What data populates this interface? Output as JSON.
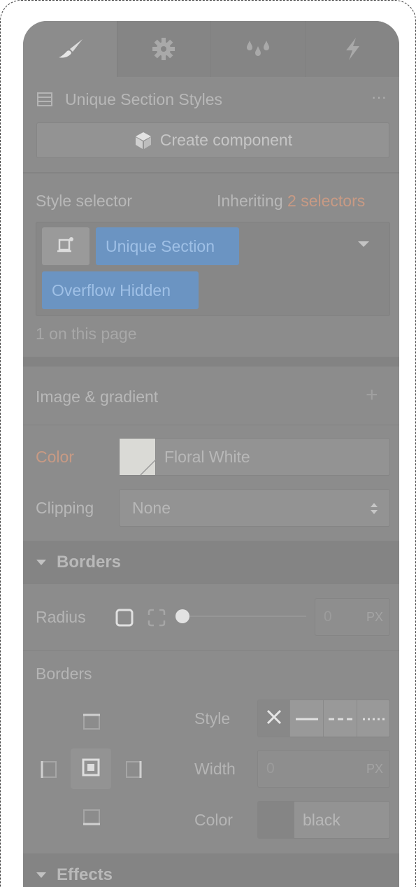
{
  "panel": {
    "tabs": [
      {
        "name": "brush-icon"
      },
      {
        "name": "gear-icon"
      },
      {
        "name": "drops-icon"
      },
      {
        "name": "lightning-icon"
      }
    ]
  },
  "element": {
    "title": "Unique Section Styles",
    "more_label": "···",
    "create_component_label": "Create component"
  },
  "selector": {
    "label": "Style selector",
    "inheriting_prefix": "Inheriting",
    "inheriting_count_label": "2 selectors",
    "tags": [
      "Unique Section",
      "Overflow Hidden"
    ],
    "page_count": "1 on this page"
  },
  "background": {
    "image_gradient_label": "Image & gradient",
    "add_label": "+",
    "color_label": "Color",
    "color_value": "Floral White",
    "clipping_label": "Clipping",
    "clipping_value": "None"
  },
  "borders": {
    "section_title": "Borders",
    "radius_label": "Radius",
    "radius_value": "0",
    "radius_unit": "PX",
    "subheading": "Borders",
    "style_label": "Style",
    "width_label": "Width",
    "width_value": "0",
    "width_unit": "PX",
    "color_label": "Color",
    "color_value": "black"
  },
  "effects": {
    "section_title": "Effects"
  },
  "colors": {
    "accent_orange": "#c89a84",
    "tag_blue": "#6b94c2",
    "panel_bg": "#8c8c8c"
  }
}
